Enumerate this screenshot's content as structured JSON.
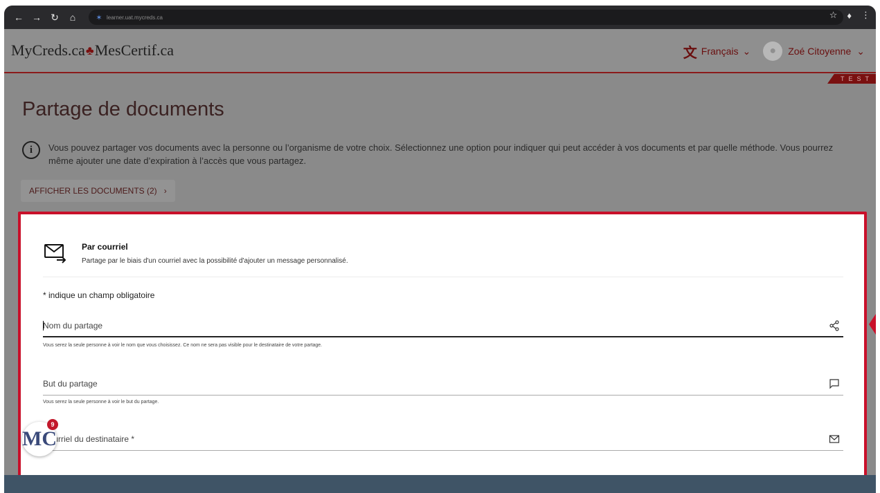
{
  "browser": {
    "url": "learner.uat.mycreds.ca",
    "back_icon": "arrow-left-icon",
    "forward_icon": "arrow-right-icon",
    "reload_icon": "reload-icon",
    "home_icon": "home-icon"
  },
  "header": {
    "logo_left": "MyCreds.ca",
    "logo_right": "MesCertif.ca",
    "language": "Français",
    "user_name": "Zoé Citoyenne",
    "env_tag": "TEST"
  },
  "page": {
    "title": "Partage de documents",
    "info_text": "Vous pouvez partager vos documents avec la personne ou l’organisme de votre choix. Sélectionnez une option pour indiquer qui peut accéder à vos documents et par quelle méthode. Vous pourrez même ajouter une date d’expiration à l’accès que vous partagez.",
    "show_docs_label": "AFFICHER LES DOCUMENTS (2)"
  },
  "share_form": {
    "method_title": "Par courriel",
    "method_desc": "Partage par le biais d'un courriel avec la possibilité d'ajouter un message personnalisé.",
    "required_note": "* indique un champ obligatoire",
    "fields": [
      {
        "label": "Nom du partage",
        "help": "Vous serez la seule personne à voir le nom que vous choisissez. Ce nom ne sera pas visible pour le destinataire de votre partage.",
        "icon": "share-icon"
      },
      {
        "label": "But du partage",
        "help": "Vous serez la seule personne à voir le but du partage.",
        "icon": "comment-icon"
      },
      {
        "label": "Courriel du destinataire *",
        "help": "",
        "icon": "mail-icon"
      }
    ]
  },
  "badge": {
    "initials": "MC",
    "count": "9"
  },
  "colors": {
    "accent": "#c9102a",
    "brand_red": "#7a1010",
    "footer": "#3f5466"
  }
}
